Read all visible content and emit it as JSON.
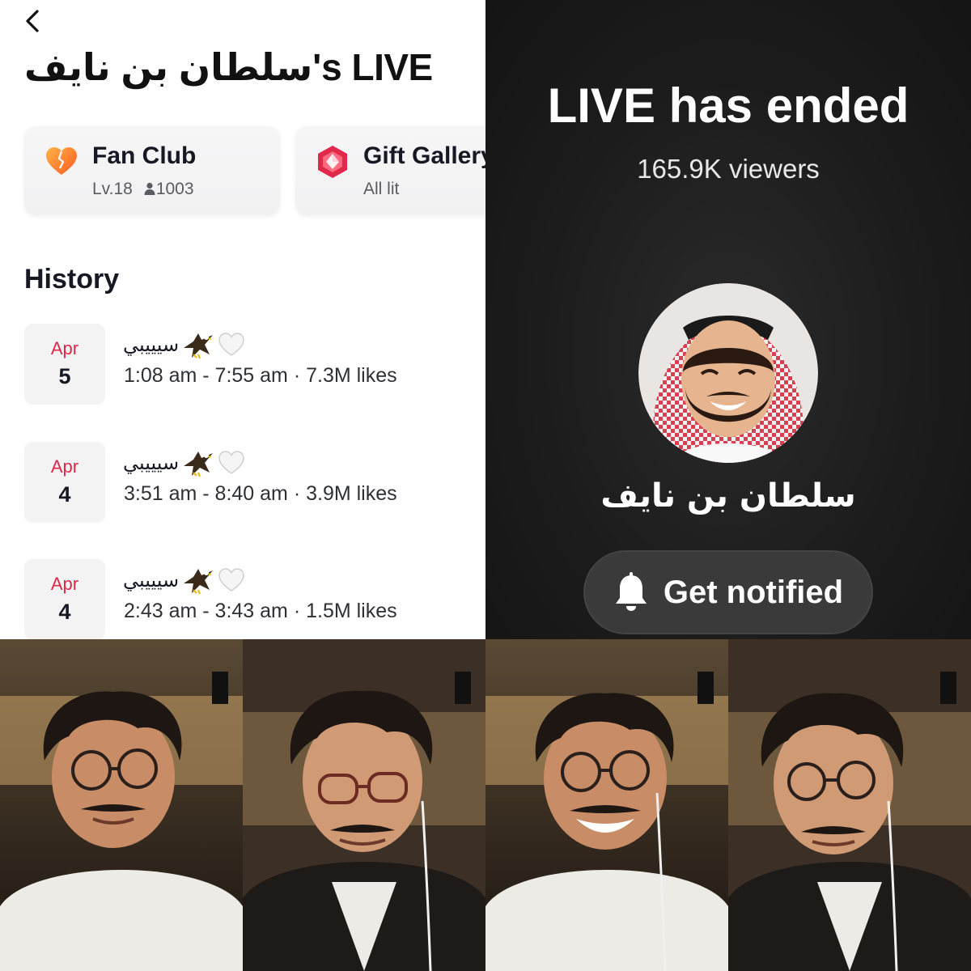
{
  "left_panel": {
    "title": "سلطان بن نايف's LIVE",
    "fan_club": {
      "title": "Fan Club",
      "level": "Lv.18",
      "members": "1003"
    },
    "gift_gallery": {
      "title": "Gift Gallery",
      "status": "All lit"
    },
    "history_heading": "History",
    "history": [
      {
        "month": "Apr",
        "day": "5",
        "title": "سيييبي",
        "detail": "1:08 am - 7:55 am · 7.3M likes"
      },
      {
        "month": "Apr",
        "day": "4",
        "title": "سيييبي",
        "detail": "3:51 am - 8:40 am · 3.9M likes"
      },
      {
        "month": "Apr",
        "day": "4",
        "title": "سيييبي",
        "detail": "2:43 am - 3:43 am · 1.5M likes"
      }
    ]
  },
  "right_panel": {
    "status_title": "LIVE has ended",
    "viewers": "165.9K viewers",
    "host_name": "سلطان بن نايف",
    "notify_label": "Get notified"
  },
  "colors": {
    "accent_red": "#e0284a",
    "dark_bg": "#1c1c1c",
    "button_bg": "#3a3a3a"
  },
  "icons": [
    "back-chevron-icon",
    "broken-heart-icon",
    "gift-gallery-icon",
    "person-icon",
    "eagle-icon",
    "white-heart-icon",
    "bell-icon"
  ]
}
